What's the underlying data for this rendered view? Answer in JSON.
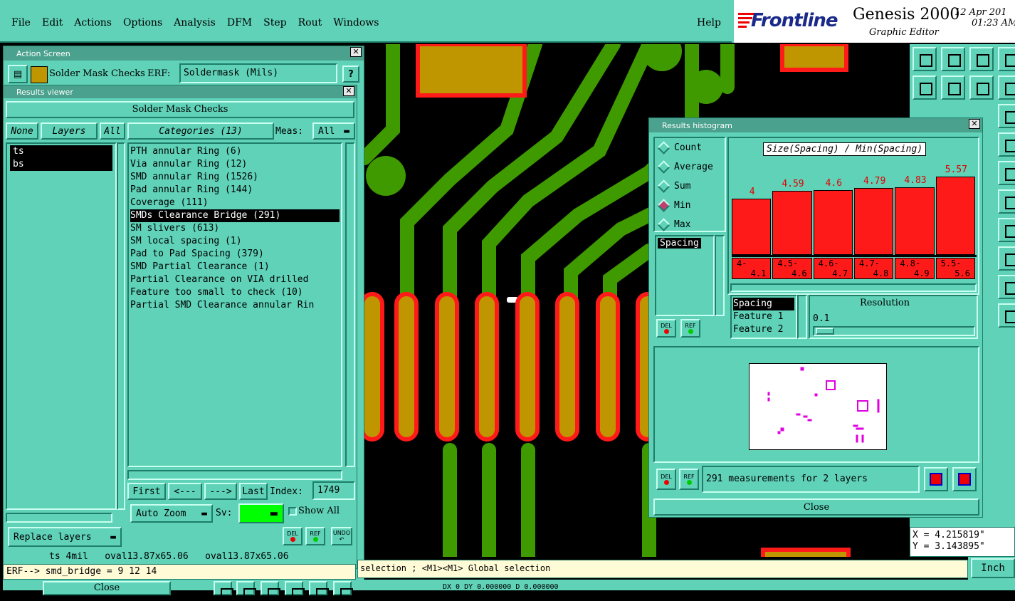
{
  "menu": {
    "items": [
      "File",
      "Edit",
      "Actions",
      "Options",
      "Analysis",
      "DFM",
      "Step",
      "Rout",
      "Windows"
    ],
    "help": "Help"
  },
  "brand": {
    "logo": "Frontline",
    "product": "Genesis 2000",
    "subtitle": "Graphic Editor",
    "date": "12 Apr 201",
    "time": "01:23 AM"
  },
  "action_screen": {
    "title": "Action Screen",
    "check_name": "Solder Mask Checks",
    "erf_label": "ERF:",
    "erf_value": "Soldermask (Mils)",
    "help_label": "?"
  },
  "results_viewer": {
    "title": "Results viewer",
    "header": "Solder Mask Checks",
    "none_label": "None",
    "layers_label": "Layers",
    "all_label": "All",
    "categories_label": "Categories (13)",
    "meas_label": "Meas:",
    "meas_value": "All",
    "layers": [
      "ts",
      "bs"
    ],
    "categories": [
      "PTH annular Ring (6)",
      "Via annular Ring (12)",
      "SMD annular Ring (1526)",
      "Pad annular Ring (144)",
      "Coverage (111)",
      "SMDs Clearance Bridge (291)",
      "SM slivers (613)",
      "SM local spacing (1)",
      "Pad to Pad Spacing (379)",
      "SMD Partial Clearance (1)",
      "Partial Clearance on VIA drilled",
      "Feature too small to check (10)",
      "Partial SMD Clearance annular Rin"
    ],
    "selected_category": 5,
    "first_label": "First",
    "prev_label": "<---",
    "next_label": "--->",
    "last_label": "Last",
    "index_label": "Index:",
    "index_value": "1749",
    "zoom_mode": "Auto Zoom",
    "sv_label": "Sv:",
    "show_all_label": "Show All",
    "replace_layers_label": "Replace layers",
    "del_label": "DEL",
    "ref_label": "REF",
    "undo_label": "UNDO",
    "status_line": "ts 4mil   oval13.87x65.06   oval13.87x65.06",
    "erf_line": "ERF--> smd_bridge = 9 12 14",
    "close_label": "Close"
  },
  "histogram": {
    "title": "Results histogram",
    "chart_title": "Size(Spacing) / Min(Spacing)",
    "modes": [
      "Count",
      "Average",
      "Sum",
      "Min",
      "Max"
    ],
    "selected_mode": "Min",
    "measure_list": [
      "Spacing"
    ],
    "del_label": "DEL",
    "ref_label": "REF",
    "feature_list": [
      "Spacing",
      "Feature 1",
      "Feature 2"
    ],
    "resolution_label": "Resolution",
    "resolution_value": "0.1",
    "measurements_text": "291 measurements for 2 layers",
    "close_label": "Close",
    "colors": {
      "bar": "#ff1a1a",
      "marker": "#e000e0"
    }
  },
  "chart_data": {
    "type": "bar",
    "title": "Size(Spacing) / Min(Spacing)",
    "categories": [
      [
        "4-",
        "4.1"
      ],
      [
        "4.5-",
        "4.6"
      ],
      [
        "4.6-",
        "4.7"
      ],
      [
        "4.7-",
        "4.8"
      ],
      [
        "4.8-",
        "4.9"
      ],
      [
        "5.5-",
        "5.6"
      ]
    ],
    "values": [
      4,
      4.59,
      4.6,
      4.79,
      4.83,
      5.57
    ],
    "value_labels": [
      "4",
      "4.59",
      "4.6",
      "4.79",
      "4.83",
      "5.57"
    ]
  },
  "coords": {
    "x": "X = 4.215819\"",
    "y": "Y = 3.143895\""
  },
  "command_line": "selection ; <M1><M1> Global selection",
  "units": "Inch",
  "bottom_line": "DX 0 DY 0.000000 D 0.000000",
  "colors": {
    "panel": "#5fd2b8",
    "trace": "#3f9a00",
    "pad": "#c09600",
    "pad_outline": "#ff1a1a"
  }
}
